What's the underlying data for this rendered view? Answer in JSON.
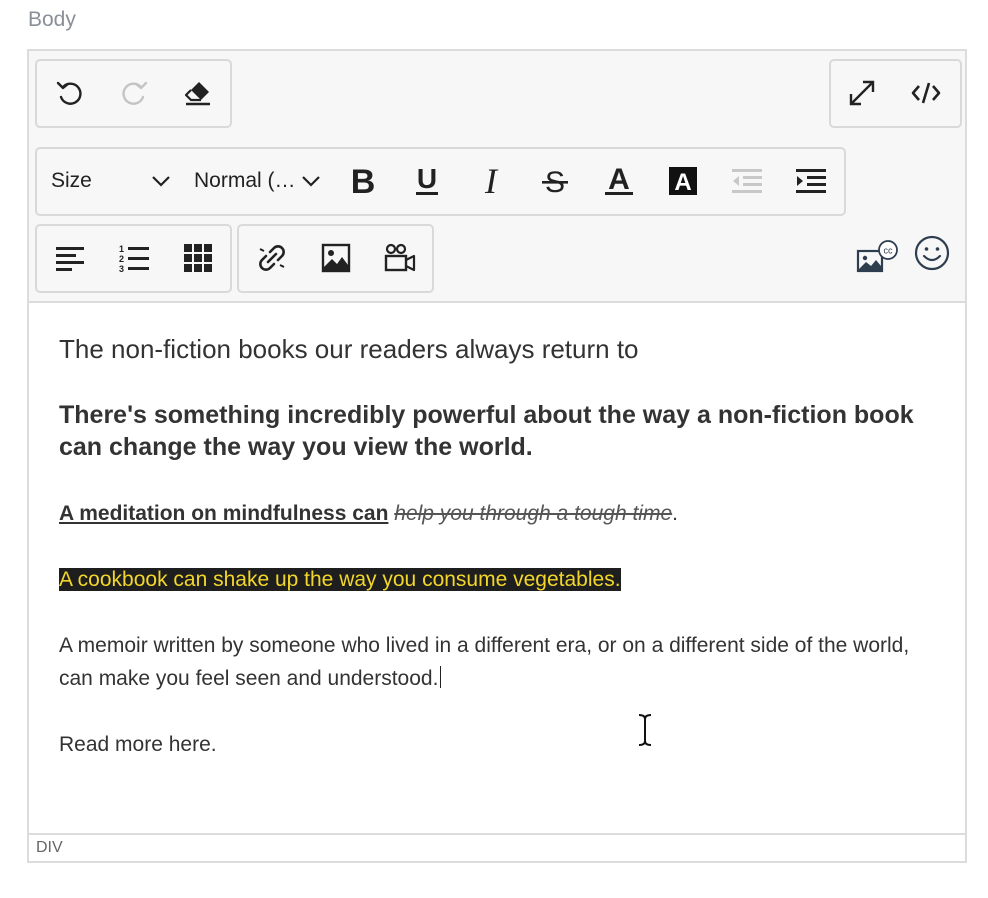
{
  "field": {
    "label": "Body"
  },
  "toolbar": {
    "history": [
      "undo-icon",
      "redo-icon",
      "clear-formatting-icon"
    ],
    "view": [
      "fullscreen-icon",
      "source-code-icon"
    ],
    "size_label": "Size",
    "format_label": "Normal (…",
    "formatting": [
      "bold-icon",
      "underline-icon",
      "italic-icon",
      "strikethrough-icon",
      "text-color-icon",
      "highlight-color-icon",
      "outdent-icon",
      "indent-icon"
    ],
    "blocks": [
      "align-icon",
      "numbered-list-icon",
      "table-icon"
    ],
    "insert": [
      "link-icon",
      "image-icon",
      "video-icon"
    ],
    "extras": [
      "accessible-media-icon",
      "emoji-icon"
    ]
  },
  "content": {
    "title": "The non-fiction books our readers always return to",
    "lead": "There's something incredibly powerful about the way a non-fiction book can change the way you view the world.",
    "p1_underlined": "A meditation on mindfulness can",
    "p1_struck": "help you through a tough time",
    "p1_end": ".",
    "p2_highlighted": "A cookbook can shake up the way you consume vegetables.",
    "p3": "A memoir written by someone who lived in a different era, or on a different side of the world, can make you feel seen and understood.",
    "p4": "Read more here."
  },
  "statusbar": {
    "path": "DIV"
  },
  "colors": {
    "highlight_bg": "#1e1e1e",
    "highlight_text": "#f2d62b"
  }
}
